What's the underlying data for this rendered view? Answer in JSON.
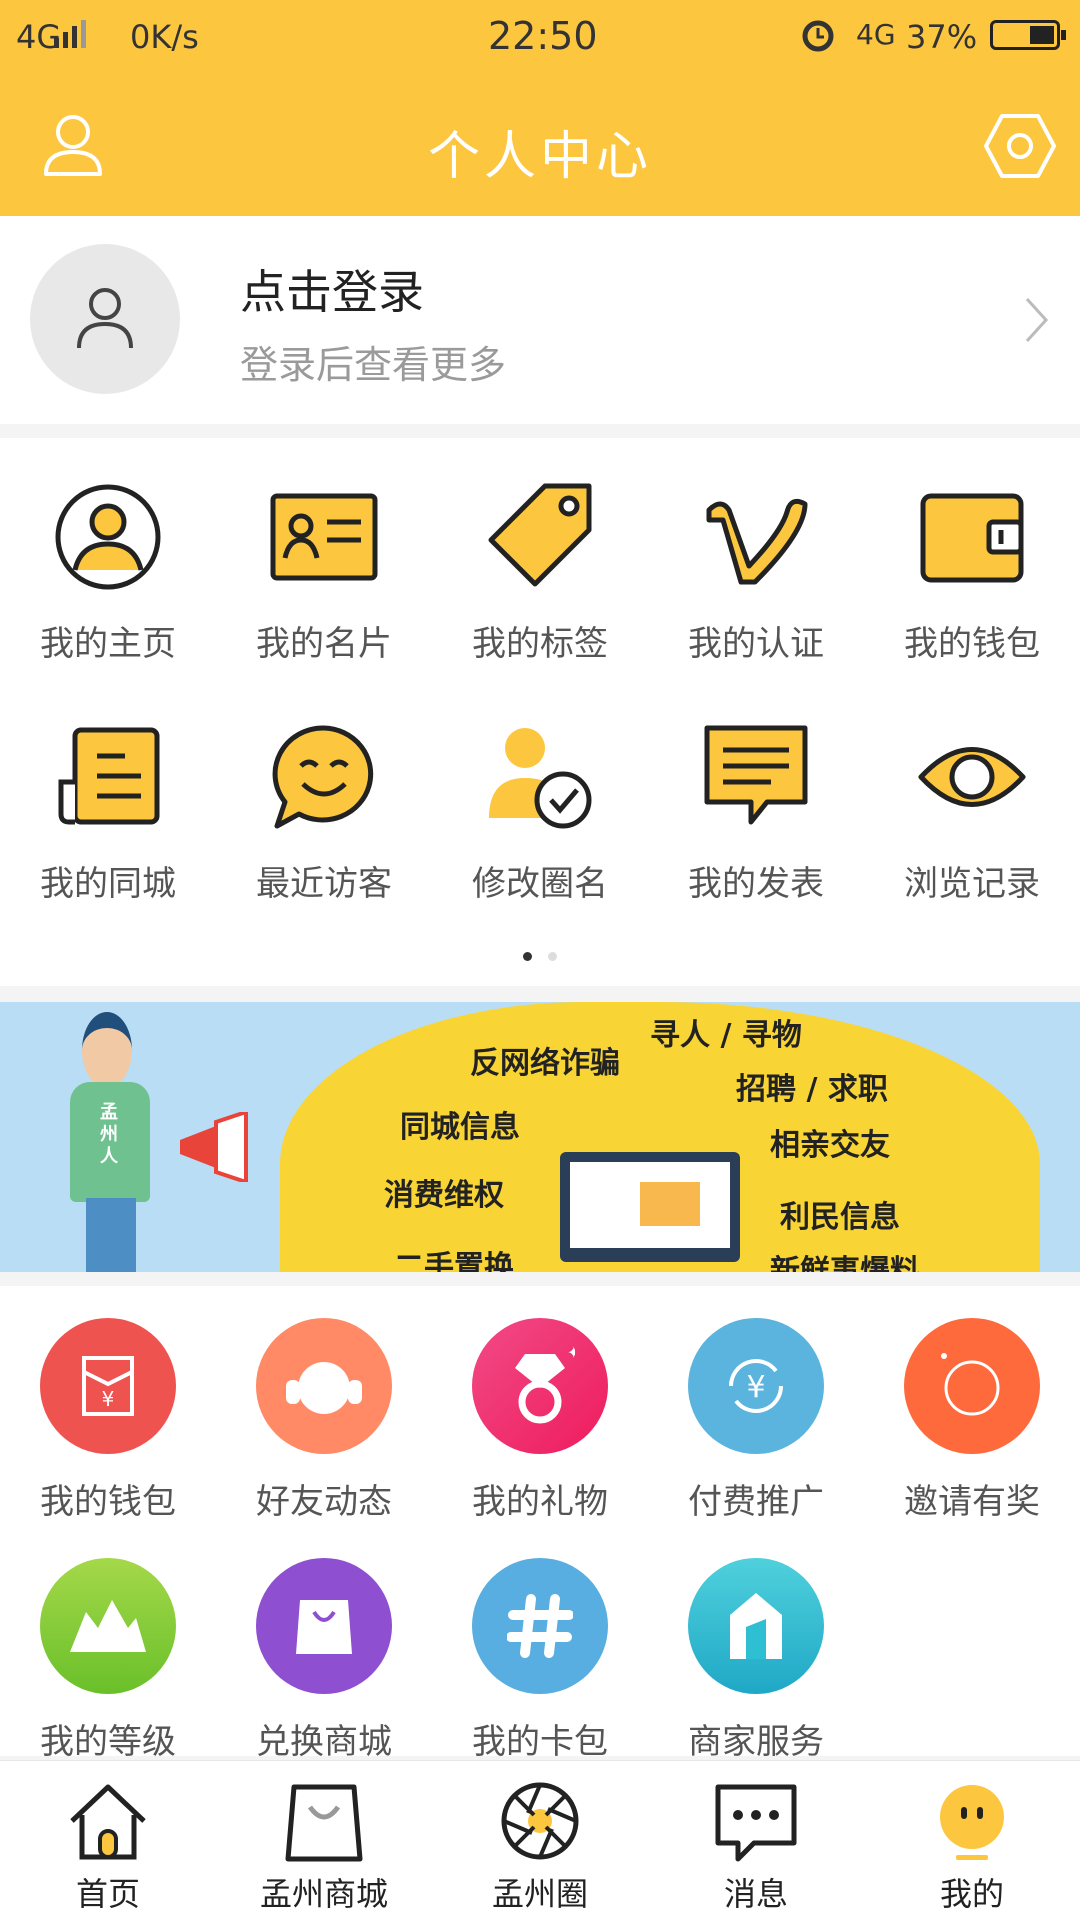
{
  "status_bar": {
    "network": "4G",
    "speed": "0K/s",
    "time": "22:50",
    "network2": "4G",
    "battery": "37%",
    "icons": [
      "signal-icon",
      "alarm-icon",
      "battery-icon"
    ]
  },
  "header": {
    "title": "个人中心",
    "left_icon": "user-icon",
    "right_icon": "settings-icon"
  },
  "profile": {
    "login_title": "点击登录",
    "login_subtitle": "登录后查看更多"
  },
  "menu_grid": {
    "items": [
      {
        "label": "我的主页",
        "icon": "homepage-icon"
      },
      {
        "label": "我的名片",
        "icon": "card-icon"
      },
      {
        "label": "我的标签",
        "icon": "tag-icon"
      },
      {
        "label": "我的认证",
        "icon": "verify-icon"
      },
      {
        "label": "我的钱包",
        "icon": "wallet-icon"
      },
      {
        "label": "我的同城",
        "icon": "city-icon"
      },
      {
        "label": "最近访客",
        "icon": "visitor-icon"
      },
      {
        "label": "修改圈名",
        "icon": "rename-icon"
      },
      {
        "label": "我的发表",
        "icon": "post-icon"
      },
      {
        "label": "浏览记录",
        "icon": "history-icon"
      }
    ],
    "page_count": 2,
    "active_page": 1
  },
  "banner": {
    "texts": [
      "反网络诈骗",
      "寻人 / 寻物",
      "招聘 / 求职",
      "同城信息",
      "相亲交友",
      "消费维权",
      "利民信息",
      "二手置换",
      "新鲜事爆料"
    ],
    "shirt_text": "孟州人"
  },
  "service_grid": {
    "items": [
      {
        "label": "我的钱包",
        "icon": "red-packet-icon",
        "color": "#ef5350"
      },
      {
        "label": "好友动态",
        "icon": "headphones-icon",
        "color": "#ff8a65"
      },
      {
        "label": "我的礼物",
        "icon": "ring-icon",
        "color": "#f0306e"
      },
      {
        "label": "付费推广",
        "icon": "yuan-icon",
        "color": "#5bb4de"
      },
      {
        "label": "邀请有奖",
        "icon": "circle-icon",
        "color": "#ff6a3d"
      },
      {
        "label": "我的等级",
        "icon": "mountain-icon",
        "color": "#7cc63a"
      },
      {
        "label": "兑换商城",
        "icon": "bag-icon",
        "color": "#8e4fd0"
      },
      {
        "label": "我的卡包",
        "icon": "hash-icon",
        "color": "#58aee0"
      },
      {
        "label": "商家服务",
        "icon": "shop-icon",
        "color": "#2fbfd2"
      }
    ]
  },
  "tabbar": {
    "items": [
      {
        "label": "首页",
        "icon": "home-icon"
      },
      {
        "label": "孟州商城",
        "icon": "shopping-bag-icon"
      },
      {
        "label": "孟州圈",
        "icon": "aperture-icon"
      },
      {
        "label": "消息",
        "icon": "message-icon"
      },
      {
        "label": "我的",
        "icon": "me-icon"
      }
    ],
    "active": "我的"
  },
  "colors": {
    "brand_yellow": "#fcc63e",
    "icon_yellow": "#fcc63e"
  }
}
